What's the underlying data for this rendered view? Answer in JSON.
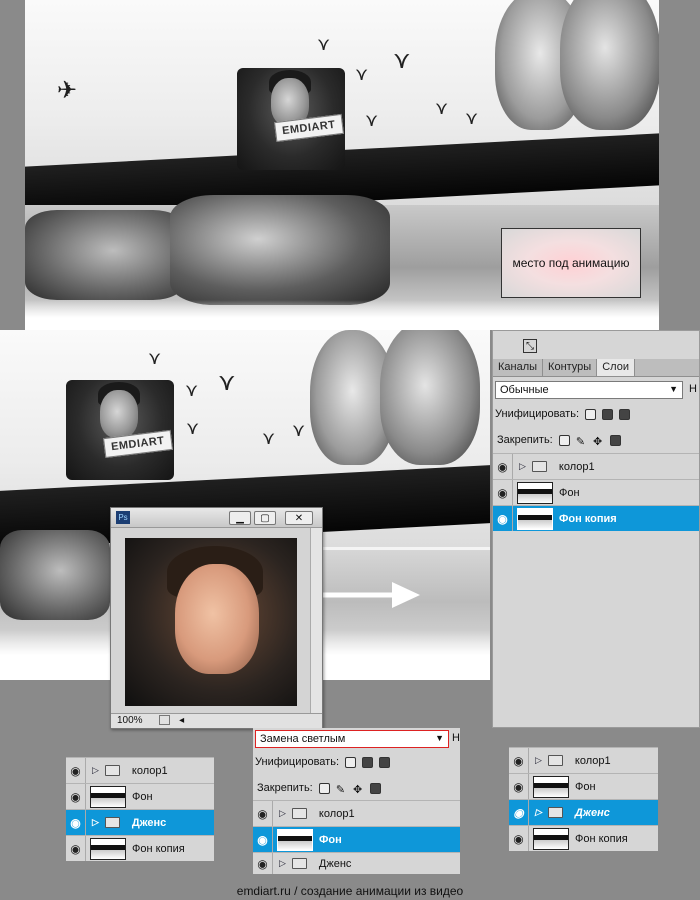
{
  "artwork": {
    "sign_text": "EMDIART",
    "placeholder_text": "место под анимацию"
  },
  "panel": {
    "tabs": [
      {
        "label": "Каналы"
      },
      {
        "label": "Контуры"
      },
      {
        "label": "Слои"
      }
    ],
    "active_tab": "Слои",
    "blend_mode": "Обычные",
    "blend_right_hint": "Н",
    "unify_label": "Унифицировать:",
    "lock_label": "Закрепить:",
    "layers": [
      {
        "name": "колор1",
        "type": "group"
      },
      {
        "name": "Фон",
        "type": "layer"
      },
      {
        "name": "Фон  копия",
        "type": "layer",
        "selected": true
      }
    ]
  },
  "ps_window": {
    "app_icon": "Ps",
    "zoom": "100%",
    "minimize_glyph": "▁",
    "maximize_glyph": "▢",
    "close_glyph": "✕"
  },
  "bottom_left": {
    "layers": [
      {
        "name": "колор1",
        "type": "group"
      },
      {
        "name": "Фон",
        "type": "layer"
      },
      {
        "name": "Дженс",
        "type": "group",
        "selected": true
      },
      {
        "name": "Фон  копия",
        "type": "layer"
      }
    ]
  },
  "bottom_center": {
    "blend_mode": "Замена светлым",
    "blend_right_hint": "Н",
    "unify_label": "Унифицировать:",
    "lock_label": "Закрепить:",
    "layers": [
      {
        "name": "колор1",
        "type": "group"
      },
      {
        "name": "Фон",
        "type": "layer",
        "selected": true
      },
      {
        "name": "Дженс",
        "type": "group"
      }
    ]
  },
  "bottom_right": {
    "layers": [
      {
        "name": "колор1",
        "type": "group"
      },
      {
        "name": "Фон",
        "type": "layer"
      },
      {
        "name": "Дженс",
        "type": "group",
        "selected": true
      },
      {
        "name": "Фон  копия",
        "type": "layer"
      }
    ]
  },
  "caption": "emdiart.ru / создание анимации из видео",
  "colors": {
    "selection": "#0e97d9",
    "panel_bg": "#d6d6d6",
    "page_bg": "#8a8a8a",
    "placeholder_glow": "#ffd0d4"
  }
}
